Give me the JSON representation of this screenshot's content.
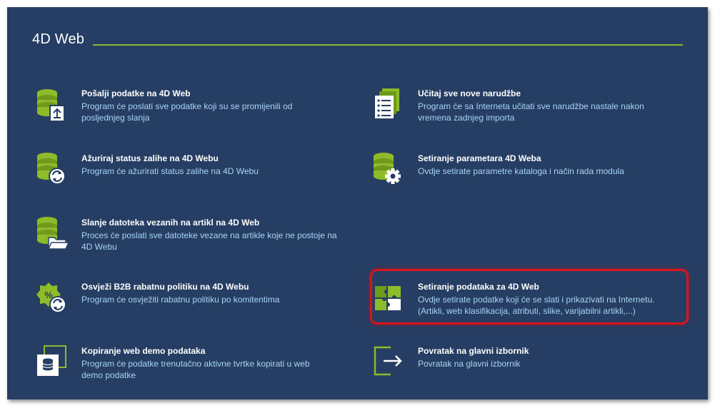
{
  "header": {
    "title": "4D Web"
  },
  "colors": {
    "background": "#263e63",
    "accent": "#8dbb2a",
    "title_text": "#ffffff",
    "description_text": "#a8d4f5",
    "highlight": "#d8141c"
  },
  "items": [
    {
      "icon": "database-upload-icon",
      "title": "Pošalji podatke na 4D Web",
      "description": "Program će poslati sve podatke koji su se promijenili od posljednjeg slanja"
    },
    {
      "icon": "document-list-icon",
      "title": "Učitaj sve nove narudžbe",
      "description": "Program će sa Interneta učitati sve narudžbe nastale nakon vremena zadnjeg importa"
    },
    {
      "icon": "database-refresh-icon",
      "title": "Ažuriraj status zalihe na 4D Webu",
      "description": "Program će ažurirati status zalihe na 4D Webu"
    },
    {
      "icon": "database-gear-icon",
      "title": "Setiranje parametara 4D Weba",
      "description": "Ovdje setirate parametre kataloga i način rada modula"
    },
    {
      "icon": "database-folder-icon",
      "title": "Slanje datoteka vezanih na artikl na 4D Web",
      "description": "Proces će poslati sve datoteke vezane na artikle koje ne postoje na 4D Webu"
    },
    {
      "icon": "puzzle-icon",
      "title": "Setiranje podataka za 4D Web",
      "description": "Ovdje setirate podatke koji će se slati i prikazivati na Internetu. (Artikli, web klasifikacija, atributi, slike, varijabilni artikli,...)"
    },
    {
      "icon": "discount-refresh-icon",
      "title": "Osvježi B2B rabatnu politiku na 4D Webu",
      "description": "Program će osvježiti rabatnu politiku po komitentima"
    },
    {
      "icon": "copy-database-icon",
      "title": "Kopiranje web demo podataka",
      "description": "Program će podatke trenutačno aktivne tvrtke kopirati u web demo podatke"
    },
    {
      "icon": "exit-arrow-icon",
      "title": "Povratak na glavni izbornik",
      "description": "Povratak na glavni izbornik"
    }
  ]
}
